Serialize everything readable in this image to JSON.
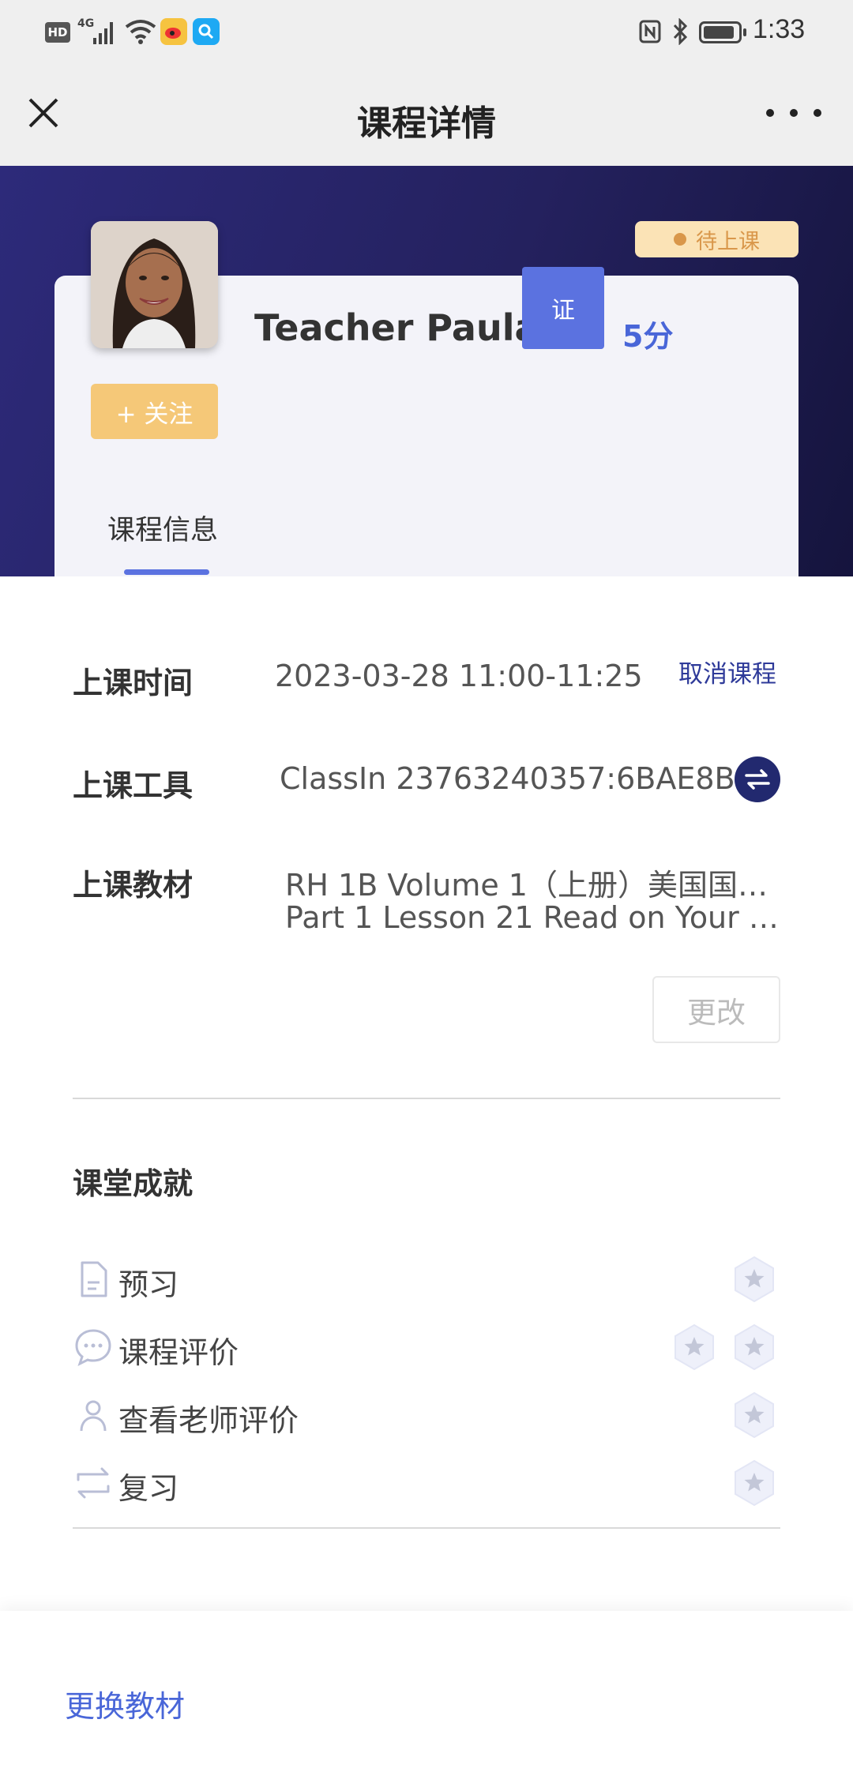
{
  "status_bar": {
    "hd": "HD",
    "signal_label": "4G",
    "time": "1:33",
    "battery_level": 0.9
  },
  "header": {
    "title": "课程详情"
  },
  "teacher": {
    "name": "Teacher Paula.",
    "cert_badge": "证",
    "score": "5分",
    "follow_label": "+ 关注",
    "status": "待上课"
  },
  "tabs": [
    "课程信息"
  ],
  "course_info": {
    "time_label": "上课时间",
    "time_value": "2023-03-28 11:00-11:25",
    "cancel_label": "取消课程",
    "tool_label": "上课工具",
    "tool_value": "ClassIn 23763240357:6BAE8B",
    "material_label": "上课教材",
    "material_line1": "RH 1B Volume 1（上册）美国国…",
    "material_line2": "Part 1 Lesson 21 Read on Your …",
    "change_label": "更改"
  },
  "achievements": {
    "title": "课堂成就",
    "items": [
      {
        "label": "预习",
        "stars": 1,
        "icon": "document-icon"
      },
      {
        "label": "课程评价",
        "stars": 2,
        "icon": "chat-icon"
      },
      {
        "label": "查看老师评价",
        "stars": 1,
        "icon": "person-icon"
      },
      {
        "label": "复习",
        "stars": 1,
        "icon": "repeat-icon"
      }
    ]
  },
  "bottom": {
    "replace_material": "更换教材"
  },
  "colors": {
    "accent": "#5b72e0",
    "link": "#2e3a99",
    "hero_dark": "#24215e",
    "follow": "#f5c878",
    "status_pill": "#fbe3b6"
  }
}
